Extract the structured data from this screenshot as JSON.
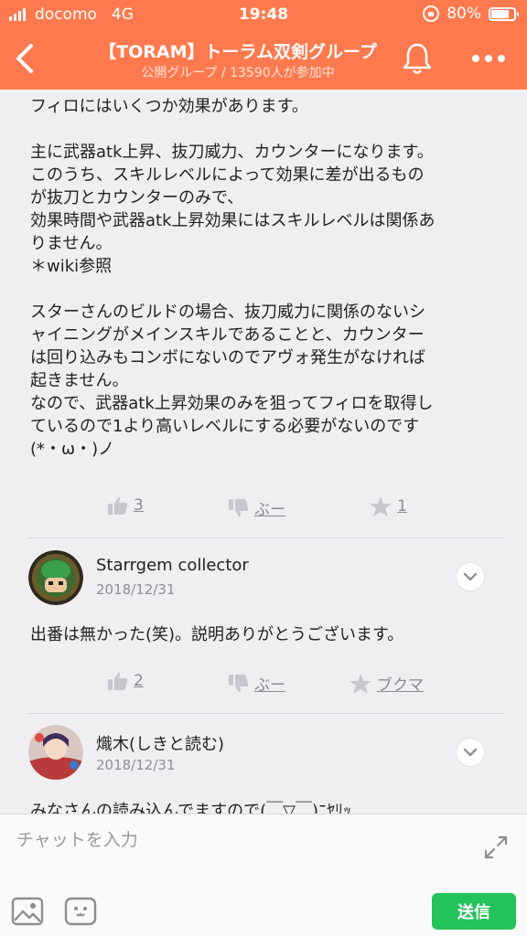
{
  "status": {
    "carrier": "docomo",
    "network": "4G",
    "time": "19:48",
    "battery": "80%",
    "battery_level": 0.8
  },
  "header": {
    "title": "【TORAM】トーラム双剣グループ",
    "subtitle": "公開グループ / 13590人が参加中"
  },
  "post": {
    "paragraphs": [
      "フィロにはいくつか効果があります。",
      "主に武器atk上昇、抜刀威力、カウンターになります。\nこのうち、スキルレベルによって効果に差が出るもの\nが抜刀とカウンターのみで、\n効果時間や武器atk上昇効果にはスキルレベルは関係あ\nりません。\n＊wiki参照",
      "スターさんのビルドの場合、抜刀威力に関係のないシ\nャイニングがメインスキルであることと、カウンター\nは回り込みもコンボにないのでアヴォ発生がなければ\n起きません。\nなので、武器atk上昇効果のみを狙ってフィロを取得し\nているので1より高いレベルにする必要がないのです\n(*・ω・)ノ"
    ],
    "actions": {
      "like": "3",
      "dislike": "ぶー",
      "favorite": "1"
    }
  },
  "comments": [
    {
      "name": "Starrgem collector",
      "date": "2018/12/31",
      "text": "出番は無かった(笑)。説明ありがとうございます。",
      "actions": {
        "like": "2",
        "dislike": "ぶー",
        "bookmark": "ブクマ"
      }
    },
    {
      "name": "熾木(しきと読む)",
      "date": "2018/12/31",
      "text": "みなさんの読み込んでますので(￣▽￣)ﾆﾔﾘｯ"
    }
  ],
  "composer": {
    "placeholder": "チャットを入力",
    "send_label": "送信"
  },
  "colors": {
    "header": "#fe7a4e",
    "send": "#22c35a",
    "background": "#efeff2"
  }
}
